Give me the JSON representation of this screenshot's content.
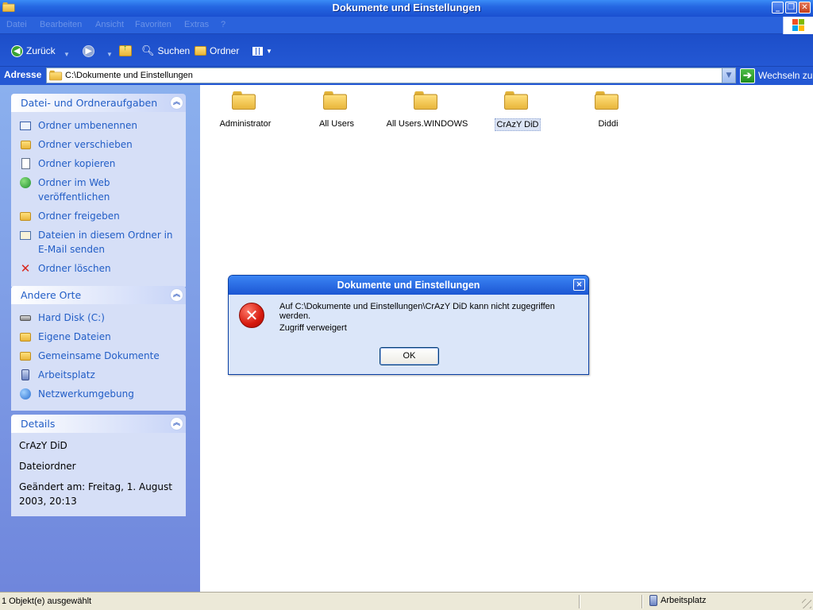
{
  "window": {
    "title": "Dokumente und Einstellungen",
    "minimize_label": "_",
    "restore_label": "❐",
    "close_label": "✕"
  },
  "menubar": {
    "items": [
      "Datei",
      "Bearbeiten",
      "Ansicht",
      "Favoriten",
      "Extras",
      "?"
    ]
  },
  "toolbar": {
    "back_label": "Zurück",
    "search_label": "Suchen",
    "folders_label": "Ordner"
  },
  "address": {
    "label": "Adresse",
    "value": "C:\\Dokumente und Einstellungen",
    "goto_label": "Wechseln zu"
  },
  "tasks_panel": {
    "title": "Datei- und Ordneraufgaben",
    "items": [
      {
        "label": "Ordner umbenennen",
        "icon": "rename-icon"
      },
      {
        "label": "Ordner verschieben",
        "icon": "move-icon"
      },
      {
        "label": "Ordner kopieren",
        "icon": "copy-icon"
      },
      {
        "label": "Ordner im Web veröffentlichen",
        "icon": "web-publish-icon"
      },
      {
        "label": "Ordner freigeben",
        "icon": "share-icon"
      },
      {
        "label": "Dateien in diesem Ordner in E-Mail senden",
        "icon": "email-icon"
      },
      {
        "label": "Ordner löschen",
        "icon": "delete-icon"
      }
    ]
  },
  "places_panel": {
    "title": "Andere Orte",
    "items": [
      {
        "label": "Hard Disk (C:)",
        "icon": "hard-disk-icon"
      },
      {
        "label": "Eigene Dateien",
        "icon": "my-documents-icon"
      },
      {
        "label": "Gemeinsame Dokumente",
        "icon": "shared-documents-icon"
      },
      {
        "label": "Arbeitsplatz",
        "icon": "my-computer-icon"
      },
      {
        "label": "Netzwerkumgebung",
        "icon": "network-icon"
      }
    ]
  },
  "details_panel": {
    "title": "Details",
    "name": "CrAzY DiD",
    "type": "Dateiordner",
    "modified": "Geändert am: Freitag, 1. August 2003, 20:13"
  },
  "folders": [
    {
      "name": "Administrator",
      "selected": false
    },
    {
      "name": "All Users",
      "selected": false
    },
    {
      "name": "All Users.WINDOWS",
      "selected": false
    },
    {
      "name": "CrAzY DiD",
      "selected": true
    },
    {
      "name": "Diddi",
      "selected": false
    }
  ],
  "dialog": {
    "title": "Dokumente und Einstellungen",
    "message": "Auf C:\\Dokumente und Einstellungen\\CrAzY DiD kann nicht zugegriffen werden.",
    "sub_message": "Zugriff verweigert",
    "ok_label": "OK",
    "close_label": "✕"
  },
  "statusbar": {
    "selection_text": "1 Objekt(e) ausgewählt",
    "location_text": "Arbeitsplatz"
  },
  "colors": {
    "titlebar": "#2567e2",
    "panel_text": "#215dc6",
    "error_red": "#d61a0e",
    "status_bg": "#ece9d8"
  }
}
